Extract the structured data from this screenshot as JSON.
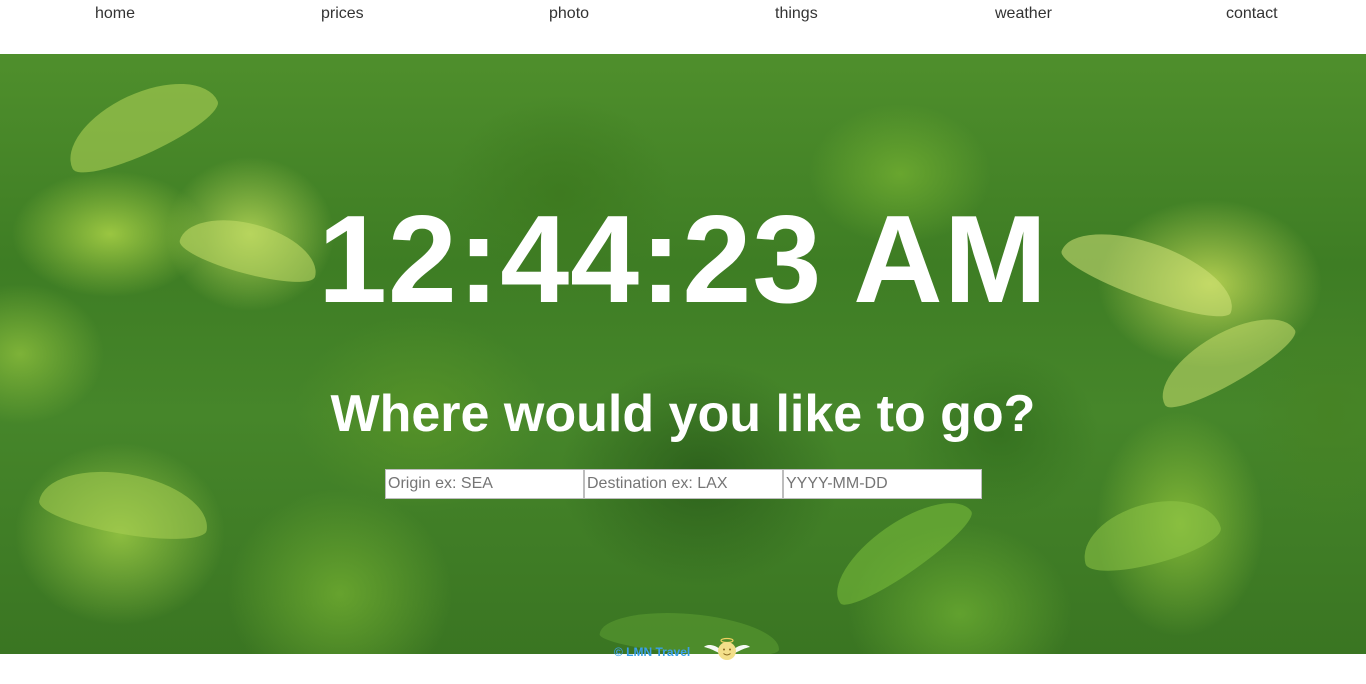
{
  "nav": {
    "items": [
      {
        "label": "home"
      },
      {
        "label": "prices"
      },
      {
        "label": "photo"
      },
      {
        "label": "things"
      },
      {
        "label": "weather"
      },
      {
        "label": "contact"
      }
    ]
  },
  "hero": {
    "clock": "12:44:23 AM",
    "headline": "Where would you like to go?"
  },
  "search": {
    "origin_placeholder": "Origin ex: SEA",
    "destination_placeholder": "Destination ex: LAX",
    "date_placeholder": "YYYY-MM-DD"
  },
  "footer": {
    "copyright": "© LMN Travel",
    "logo_icon": "winged-angel-logo-icon"
  },
  "colors": {
    "clock_text": "#ffffff",
    "footer_link": "#3aa0e8",
    "hero_background": "#3e7d24"
  }
}
